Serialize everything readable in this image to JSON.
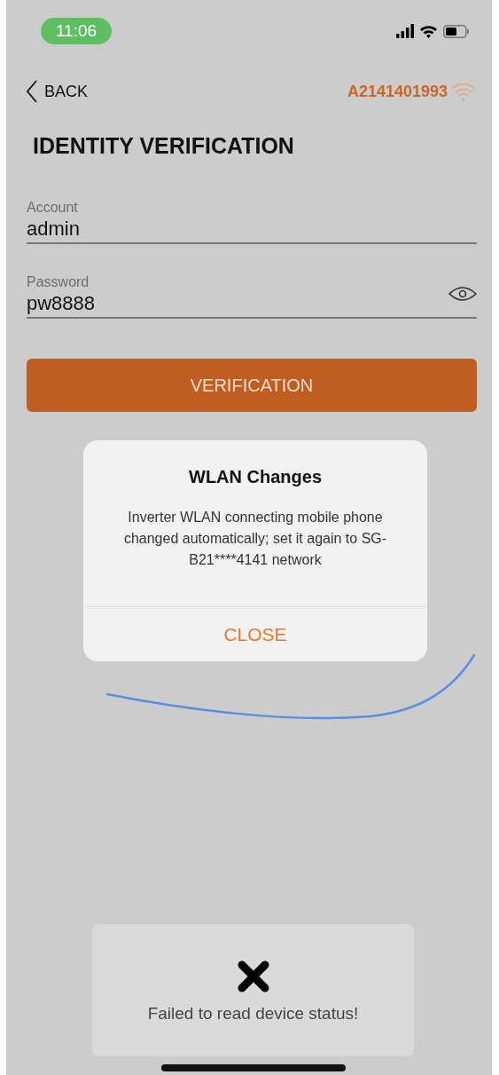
{
  "status_bar": {
    "time": "11:06"
  },
  "nav": {
    "back": "BACK",
    "device_id": "A2141401993"
  },
  "title": "IDENTITY VERIFICATION",
  "fields": [
    {
      "label": "Account",
      "value": "admin",
      "kind": "text"
    },
    {
      "label": "Password",
      "value": "pw8888",
      "kind": "password"
    }
  ],
  "primary_button": "VERIFICATION",
  "dialog": {
    "title": "WLAN Changes",
    "message": "Inverter WLAN connecting mobile phone changed automatically; set it again to SG-B21****4141 network",
    "button": "CLOSE"
  },
  "toast": {
    "message": "Failed to read device status!"
  }
}
